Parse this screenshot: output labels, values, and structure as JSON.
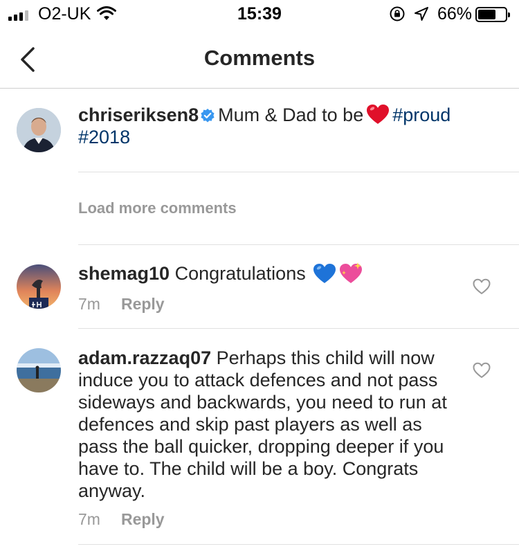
{
  "status_bar": {
    "carrier": "O2-UK",
    "time": "15:39",
    "battery": "66%",
    "battery_level": 0.66
  },
  "nav": {
    "title": "Comments",
    "back_icon": "chevron-left-icon"
  },
  "caption": {
    "username": "chriseriksen8",
    "verified": true,
    "text": "Mum & Dad to be",
    "emoji": "red-heart",
    "hashtags": [
      "#proud",
      "#2018"
    ]
  },
  "load_more": "Load more comments",
  "comments": [
    {
      "username": "shemag10",
      "text": "Congratulations",
      "emojis": [
        "blue-heart",
        "sparkling-heart"
      ],
      "time": "7m",
      "reply": "Reply"
    },
    {
      "username": "adam.razzaq07",
      "text": "Perhaps this child will now induce you to attack defences and not pass sideways and backwards, you need to run at defences and skip past players as well as pass the ball quicker, dropping deeper if you have to. The child will be a boy. Congrats anyway.",
      "time": "7m",
      "reply": "Reply"
    }
  ],
  "colors": {
    "text": "#262626",
    "hashtag": "#003569",
    "muted": "#999999",
    "verified": "#3897f0"
  }
}
